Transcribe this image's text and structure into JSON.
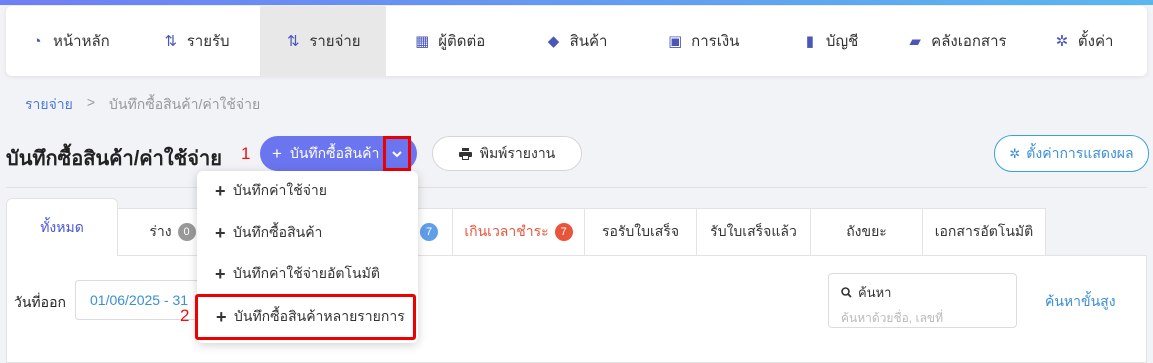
{
  "nav": {
    "items": [
      {
        "label": "หน้าหลัก",
        "icon": "dashboard-icon",
        "glyph": "◔",
        "active": false
      },
      {
        "label": "รายรับ",
        "icon": "income-icon",
        "glyph": "⇅",
        "active": false
      },
      {
        "label": "รายจ่าย",
        "icon": "expense-icon",
        "glyph": "⇅",
        "active": true
      },
      {
        "label": "ผู้ติดต่อ",
        "icon": "contacts-icon",
        "glyph": "▦",
        "active": false
      },
      {
        "label": "สินค้า",
        "icon": "box-icon",
        "glyph": "◆",
        "active": false
      },
      {
        "label": "การเงิน",
        "icon": "money-icon",
        "glyph": "▣",
        "active": false
      },
      {
        "label": "บัญชี",
        "icon": "book-icon",
        "glyph": "▮",
        "active": false
      },
      {
        "label": "คลังเอกสาร",
        "icon": "folder-icon",
        "glyph": "▰",
        "active": false
      },
      {
        "label": "ตั้งค่า",
        "icon": "gear-icon",
        "glyph": "✲",
        "active": false
      }
    ]
  },
  "breadcrumb": {
    "parent": "รายจ่าย",
    "separator": ">",
    "current": "บันทึกซื้อสินค้า/ค่าใช้จ่าย"
  },
  "page": {
    "title": "บันทึกซื้อสินค้า/ค่าใช้จ่าย",
    "annotation_1": "1",
    "annotation_2": "2"
  },
  "toolbar": {
    "add_label": "บันทึกซื้อสินค้า",
    "add_plus": "+",
    "print_label": "พิมพ์รายงาน",
    "display_settings_label": "ตั้งค่าการแสดงผล"
  },
  "dropdown": {
    "items": [
      {
        "label": "บันทึกค่าใช้จ่าย"
      },
      {
        "label": "บันทึกซื้อสินค้า"
      },
      {
        "label": "บันทึกค่าใช้จ่ายอัตโนมัติ"
      },
      {
        "label": "บันทึกซื้อสินค้าหลายรายการ"
      }
    ]
  },
  "tabs": [
    {
      "label": "ทั้งหมด",
      "badge": null
    },
    {
      "label": "ร่าง",
      "badge": "0"
    },
    {
      "label": "",
      "badge": "7"
    },
    {
      "label": "เกินเวลาชำระ",
      "badge": "7"
    },
    {
      "label": "รอรับใบเสร็จ",
      "badge": null
    },
    {
      "label": "รับใบเสร็จแล้ว",
      "badge": null
    },
    {
      "label": "ถังขยะ",
      "badge": null
    },
    {
      "label": "เอกสารอัตโนมัติ",
      "badge": null
    }
  ],
  "filters": {
    "date_label": "วันที่ออก",
    "date_value": "01/06/2025 - 31",
    "search_label": "ค้นหา",
    "search_placeholder": "ค้นหาด้วยชื่อ, เลขที่",
    "advanced_search": "ค้นหาขั้นสูง"
  },
  "colors": {
    "accent": "#6b75ef",
    "link": "#3a8fd6",
    "overdue": "#e8553a",
    "annotation": "#e00000"
  }
}
